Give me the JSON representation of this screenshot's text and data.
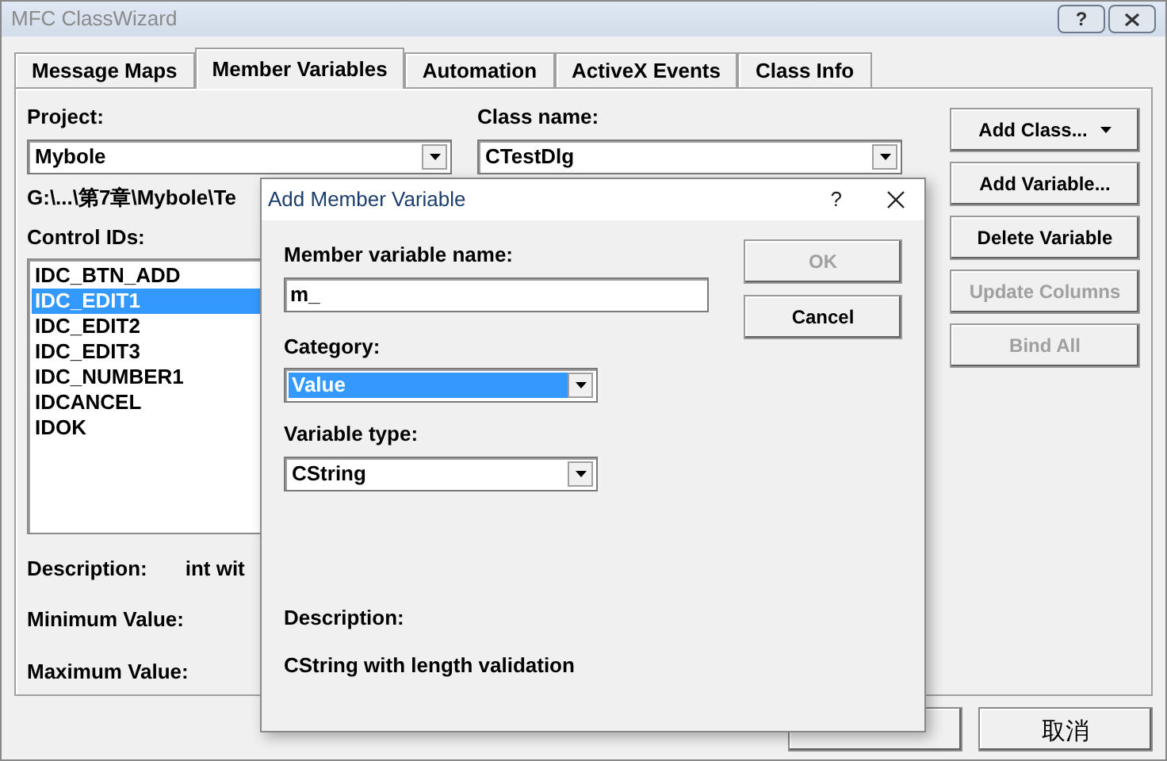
{
  "window": {
    "title": "MFC ClassWizard",
    "help": "?"
  },
  "tabs": [
    {
      "label": "Message Maps",
      "selected": false
    },
    {
      "label": "Member Variables",
      "selected": true
    },
    {
      "label": "Automation",
      "selected": false
    },
    {
      "label": "ActiveX Events",
      "selected": false
    },
    {
      "label": "Class Info",
      "selected": false
    }
  ],
  "project": {
    "label": "Project:",
    "value": "Mybole"
  },
  "class_name": {
    "label": "Class name:",
    "value": "CTestDlg"
  },
  "side_buttons": [
    {
      "label": "Add Class...",
      "disabled": false,
      "menu": true
    },
    {
      "label": "Add Variable...",
      "disabled": false,
      "menu": false
    },
    {
      "label": "Delete Variable",
      "disabled": false,
      "menu": false
    },
    {
      "label": "Update Columns",
      "disabled": true,
      "menu": false
    },
    {
      "label": "Bind All",
      "disabled": true,
      "menu": false
    }
  ],
  "path": "G:\\...\\第7章\\Mybole\\Te",
  "control_ids": {
    "label": "Control IDs:",
    "items": [
      {
        "label": "IDC_BTN_ADD",
        "selected": false
      },
      {
        "label": "IDC_EDIT1",
        "selected": true
      },
      {
        "label": "IDC_EDIT2",
        "selected": false
      },
      {
        "label": "IDC_EDIT3",
        "selected": false
      },
      {
        "label": "IDC_NUMBER1",
        "selected": false
      },
      {
        "label": "IDCANCEL",
        "selected": false
      },
      {
        "label": "IDOK",
        "selected": false
      }
    ]
  },
  "description": {
    "label": "Description:",
    "value": "int wit"
  },
  "minimum_value": {
    "label": "Minimum Value:"
  },
  "maximum_value": {
    "label": "Maximum Value:"
  },
  "footer_buttons": [
    {
      "kind": "covered"
    },
    {
      "kind": "button",
      "label": "取消"
    }
  ],
  "dialog": {
    "title": "Add Member Variable",
    "help": "?",
    "name_field": {
      "label": "Member variable name:",
      "value": "m_"
    },
    "category": {
      "label": "Category:",
      "value": "Value"
    },
    "variable_type": {
      "label": "Variable type:",
      "value": "CString"
    },
    "buttons": [
      {
        "label": "OK",
        "disabled": true
      },
      {
        "label": "Cancel",
        "disabled": false
      }
    ],
    "description": {
      "label": "Description:",
      "value": "CString with length validation"
    }
  }
}
